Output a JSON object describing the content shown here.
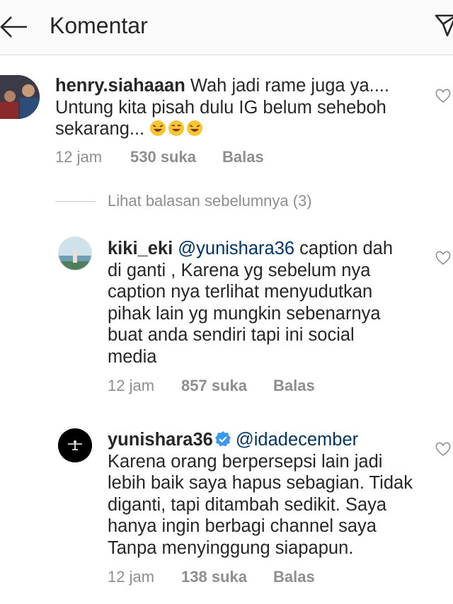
{
  "header": {
    "title": "Komentar"
  },
  "comments": [
    {
      "username": "henry.siahaaan",
      "text": "Wah jadi rame juga ya.... Untung kita pisah dulu IG belum seheboh sekarang... ",
      "emojis": [
        "rolling-on-floor-laughing",
        "grinning-squinting",
        "rolling-on-floor-laughing"
      ],
      "time": "12 jam",
      "likes": "530 suka",
      "reply": "Balas"
    },
    {
      "username": "kiki_eki",
      "mention": "@yunishara36",
      "text": " caption dah di ganti , Karena yg sebelum nya caption nya terlihat menyudutkan pihak lain yg mungkin sebenarnya buat anda sendiri tapi ini social media",
      "time": "12 jam",
      "likes": "857 suka",
      "reply": "Balas"
    },
    {
      "username": "yunishara36",
      "verified": true,
      "mention": "@idadecember",
      "text": "Karena orang berpersepsi lain jadi lebih baik saya hapus sebagian. Tidak diganti, tapi ditambah sedikit. Saya hanya ingin berbagi channel saya Tanpa menyinggung siapapun.",
      "time": "12 jam",
      "likes": "138 suka",
      "reply": "Balas"
    }
  ],
  "view_replies": "Lihat balasan sebelumnya (3)",
  "colors": {
    "mention": "#003569",
    "meta": "#8e8e8e",
    "verified": "#3897f0"
  }
}
